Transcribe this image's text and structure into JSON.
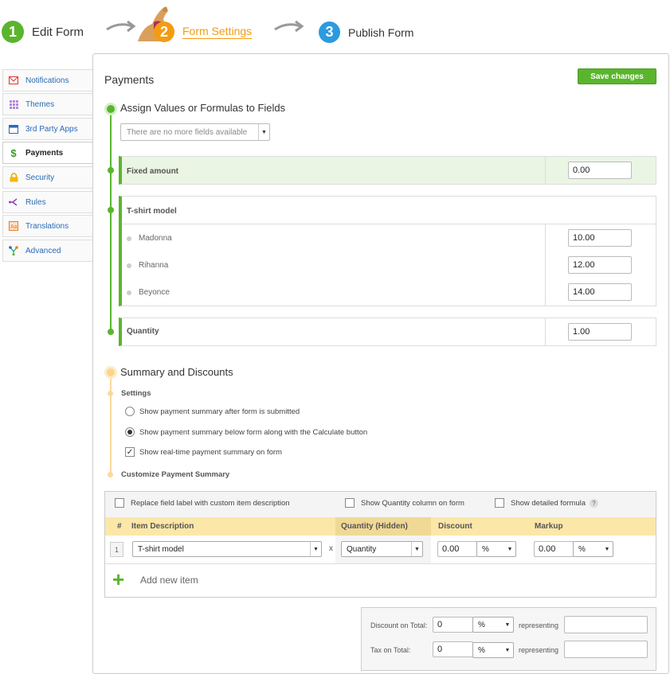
{
  "wizard": {
    "steps": [
      {
        "number": "1",
        "label": "Edit Form",
        "color": "#5ab52d"
      },
      {
        "number": "2",
        "label": "Form Settings",
        "color": "#f39c12"
      },
      {
        "number": "3",
        "label": "Publish Form",
        "color": "#2b9be0"
      }
    ]
  },
  "sidebar": {
    "items": [
      {
        "label": "Notifications",
        "icon": "envelope-icon"
      },
      {
        "label": "Themes",
        "icon": "grid-icon"
      },
      {
        "label": "3rd Party Apps",
        "icon": "window-icon"
      },
      {
        "label": "Payments",
        "icon": "dollar-icon"
      },
      {
        "label": "Security",
        "icon": "lock-icon"
      },
      {
        "label": "Rules",
        "icon": "branch-icon"
      },
      {
        "label": "Translations",
        "icon": "translate-icon"
      },
      {
        "label": "Advanced",
        "icon": "network-icon"
      }
    ]
  },
  "panel": {
    "title": "Payments",
    "save_label": "Save changes"
  },
  "assign": {
    "heading": "Assign Values or Formulas to Fields",
    "dropdown_text": "There are no more fields available",
    "fixed_label": "Fixed amount",
    "fixed_value": "0.00",
    "tshirt_label": "T-shirt model",
    "options": [
      {
        "label": "Madonna",
        "value": "10.00"
      },
      {
        "label": "Rihanna",
        "value": "12.00"
      },
      {
        "label": "Beyonce",
        "value": "14.00"
      }
    ],
    "quantity_label": "Quantity",
    "quantity_value": "1.00"
  },
  "summary": {
    "heading": "Summary and Discounts",
    "settings_label": "Settings",
    "opt1": "Show payment summary after form is submitted",
    "opt2": "Show payment summary below form along with the Calculate button",
    "opt3": "Show real-time payment summary on form",
    "customize_label": "Customize Payment Summary"
  },
  "table": {
    "check1": "Replace field label with custom item description",
    "check2": "Show Quantity column on form",
    "check3": "Show detailed formula",
    "help": "?",
    "col_num": "#",
    "col_item": "Item Description",
    "col_qty": "Quantity (Hidden)",
    "col_discount": "Discount",
    "col_markup": "Markup",
    "row_num": "1",
    "row_item": "T-shirt model",
    "row_x": "x",
    "row_qty": "Quantity",
    "row_discount": "0.00",
    "row_discount_unit": "%",
    "row_markup": "0.00",
    "row_markup_unit": "%",
    "add_label": "Add new item",
    "add_icon": "+"
  },
  "totals": {
    "discount_label": "Discount on Total:",
    "discount_value": "0",
    "discount_unit": "%",
    "tax_label": "Tax on Total:",
    "tax_value": "0",
    "tax_unit": "%",
    "representing": "representing"
  }
}
